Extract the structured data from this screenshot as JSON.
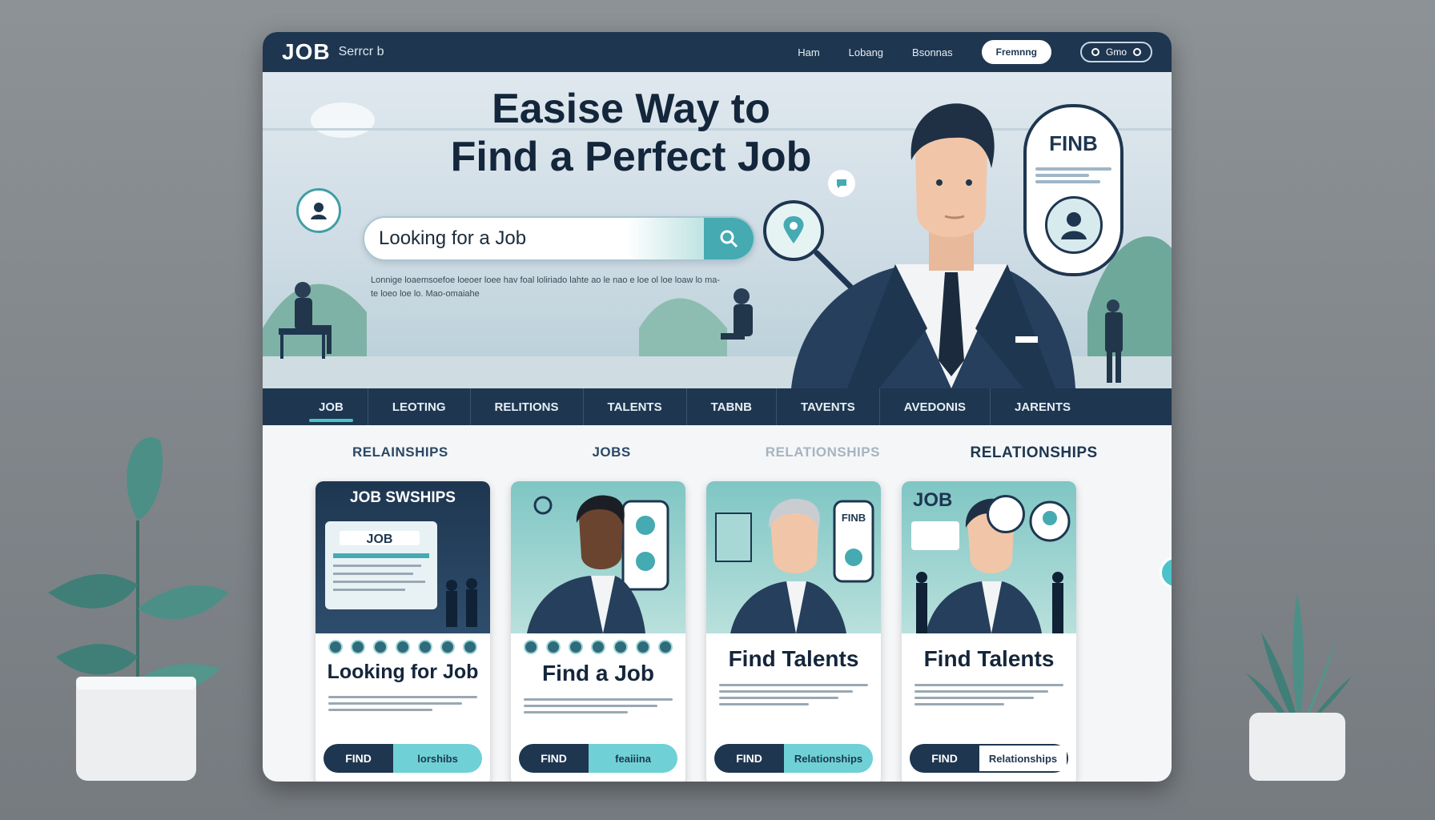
{
  "app": {
    "logo": "JOB",
    "brand_sub": "Serrcr b"
  },
  "topnav": {
    "items": [
      "Ham",
      "Lobang",
      "Bsonnas"
    ],
    "button": "Fremnng",
    "toggle": "Gmo"
  },
  "hero": {
    "title_line1": "Easise Way to",
    "title_line2": "Find a Perfect Job",
    "search_value": "Looking for a Job",
    "description": "Lonnige loaemsoefoe loeoer loee hav foal loliriado lahte ao le nao e loe ol loe loaw lo ma-te loeo loe lo. Mao-omaiahe",
    "card_title": "FINB"
  },
  "tabs": [
    "JOB",
    "LEOTING",
    "RELITIONS",
    "TALENTS",
    "TABNB",
    "TAVENTS",
    "AVEDONIS",
    "JARENTS"
  ],
  "sections": [
    "RELAINSHIPS",
    "JOBS",
    "RELATIONSHIPS",
    "RELATIONSHIPS"
  ],
  "cards": [
    {
      "banner": "JOB SWSHIPS",
      "title": "Looking for Job",
      "btn_left": "FIND",
      "btn_right": "lorshibs",
      "style": "navy"
    },
    {
      "banner": "",
      "title": "Find a Job",
      "btn_left": "FIND",
      "btn_right": "feaiiina",
      "style": "teal"
    },
    {
      "banner": "",
      "title": "Find Talents",
      "btn_left": "FIND",
      "btn_right": "Relationships",
      "style": "teal"
    },
    {
      "banner": "JOB",
      "title": "Find Talents",
      "btn_left": "FIND",
      "btn_right": "Relationships",
      "style": "teal"
    }
  ],
  "colors": {
    "navy": "#1e3650",
    "accent": "#4cc3c9",
    "teal": "#45aab2"
  }
}
